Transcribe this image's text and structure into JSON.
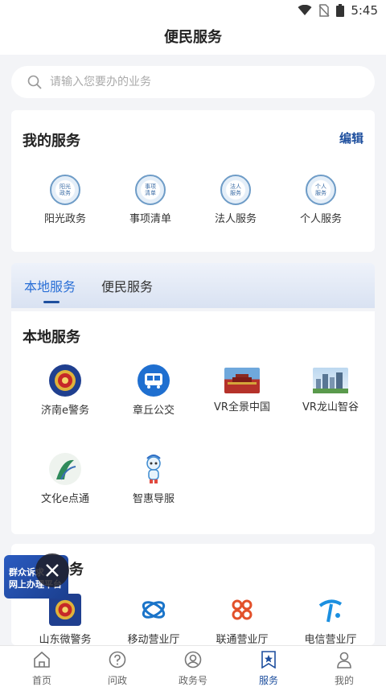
{
  "status": {
    "time": "5:45"
  },
  "header": {
    "title": "便民服务"
  },
  "search": {
    "placeholder": "请输入您要办的业务"
  },
  "my_services": {
    "title": "我的服务",
    "edit_label": "编辑",
    "items": [
      {
        "label": "阳光政务",
        "seal_text": "阳光政务",
        "icon": "seal-icon"
      },
      {
        "label": "事项清单",
        "seal_text": "事项清单",
        "icon": "seal-icon"
      },
      {
        "label": "法人服务",
        "seal_text": "法人服务",
        "icon": "seal-icon"
      },
      {
        "label": "个人服务",
        "seal_text": "个人服务",
        "icon": "seal-icon"
      }
    ]
  },
  "tabs": [
    {
      "label": "本地服务",
      "active": true
    },
    {
      "label": "便民服务",
      "active": false
    }
  ],
  "local_services": {
    "title": "本地服务",
    "items": [
      {
        "label": "济南e警务",
        "icon": "police-badge-icon"
      },
      {
        "label": "章丘公交",
        "icon": "bus-icon"
      },
      {
        "label": "VR全景中国",
        "icon": "landmark-icon"
      },
      {
        "label": "VR龙山智谷",
        "icon": "city-icon"
      },
      {
        "label": "文化e点通",
        "icon": "culture-icon"
      },
      {
        "label": "智惠导服",
        "icon": "mascot-icon"
      }
    ]
  },
  "convenience_services": {
    "title_visible": "务",
    "items": [
      {
        "label": "山东微警务",
        "icon": "police-badge-icon"
      },
      {
        "label": "移动营业厅",
        "icon": "china-mobile-icon"
      },
      {
        "label": "联通营业厅",
        "icon": "china-unicom-icon"
      },
      {
        "label": "电信营业厅",
        "icon": "china-telecom-icon"
      }
    ]
  },
  "float_banner": {
    "line1": "群众诉求",
    "line2": "网上办理平台"
  },
  "bottom_nav": [
    {
      "label": "首页",
      "icon": "home-icon",
      "active": false
    },
    {
      "label": "问政",
      "icon": "question-icon",
      "active": false
    },
    {
      "label": "政务号",
      "icon": "account-icon",
      "active": false
    },
    {
      "label": "服务",
      "icon": "star-bookmark-icon",
      "active": true
    },
    {
      "label": "我的",
      "icon": "user-icon",
      "active": false
    }
  ],
  "colors": {
    "accent": "#1e4f9e",
    "tab_active": "#2a6fd6",
    "background": "#f3f4f7"
  }
}
